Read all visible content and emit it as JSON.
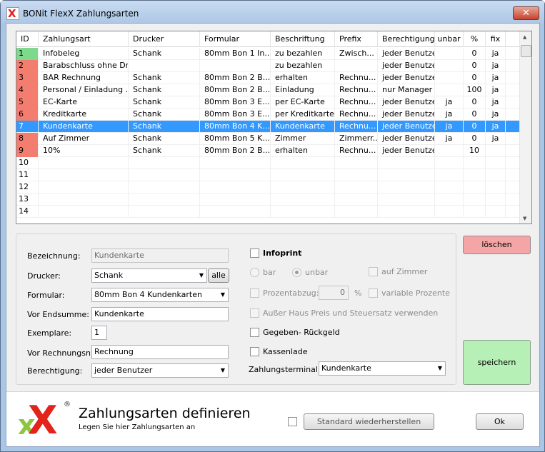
{
  "window": {
    "title": "BONit FlexX Zahlungsarten",
    "close_glyph": "✕"
  },
  "grid": {
    "columns": [
      "ID",
      "Zahlungsart",
      "Drucker",
      "Formular",
      "Beschriftung",
      "Prefix",
      "Berechtigung",
      "unbar",
      "%",
      "fix"
    ],
    "rows": [
      {
        "id": "1",
        "zahlungsart": "Infobeleg",
        "drucker": "Schank",
        "formular": "80mm Bon 1   In...",
        "beschriftung": "zu bezahlen",
        "prefix": "Zwisch...",
        "berechtigung": "jeder Benutzer",
        "unbar": "",
        "pct": "0",
        "fix": "ja",
        "color": "#7fd98c",
        "selected": false
      },
      {
        "id": "2",
        "zahlungsart": "Barabschluss ohne Dr...",
        "drucker": "",
        "formular": "",
        "beschriftung": "zu bezahlen",
        "prefix": "",
        "berechtigung": "jeder Benutzer",
        "unbar": "",
        "pct": "0",
        "fix": "ja",
        "color": "#f37d6f",
        "selected": false
      },
      {
        "id": "3",
        "zahlungsart": "BAR Rechnung",
        "drucker": "Schank",
        "formular": "80mm Bon 2   B...",
        "beschriftung": "erhalten",
        "prefix": "Rechnu...",
        "berechtigung": "jeder Benutzer",
        "unbar": "",
        "pct": "0",
        "fix": "ja",
        "color": "#f37d6f",
        "selected": false
      },
      {
        "id": "4",
        "zahlungsart": "Personal / Einladung ...",
        "drucker": "Schank",
        "formular": "80mm Bon 2   B...",
        "beschriftung": "Einladung",
        "prefix": "Rechnu...",
        "berechtigung": "nur Manager",
        "unbar": "",
        "pct": "100",
        "fix": "ja",
        "color": "#f37d6f",
        "selected": false
      },
      {
        "id": "5",
        "zahlungsart": "EC-Karte",
        "drucker": "Schank",
        "formular": "80mm Bon 3   E...",
        "beschriftung": "per EC-Karte",
        "prefix": "Rechnu...",
        "berechtigung": "jeder Benutzer",
        "unbar": "ja",
        "pct": "0",
        "fix": "ja",
        "color": "#f37d6f",
        "selected": false
      },
      {
        "id": "6",
        "zahlungsart": "Kreditkarte",
        "drucker": "Schank",
        "formular": "80mm Bon 3   E...",
        "beschriftung": "per Kreditkarte",
        "prefix": "Rechnu...",
        "berechtigung": "jeder Benutzer",
        "unbar": "ja",
        "pct": "0",
        "fix": "ja",
        "color": "#f37d6f",
        "selected": false
      },
      {
        "id": "7",
        "zahlungsart": "Kundenkarte",
        "drucker": "Schank",
        "formular": "80mm Bon 4   K...",
        "beschriftung": "Kundenkarte",
        "prefix": "Rechnu...",
        "berechtigung": "jeder Benutzer",
        "unbar": "ja",
        "pct": "0",
        "fix": "ja",
        "color": "",
        "selected": true
      },
      {
        "id": "8",
        "zahlungsart": "Auf Zimmer",
        "drucker": "Schank",
        "formular": "80mm Bon 5   K...",
        "beschriftung": "Zimmer",
        "prefix": "Zimmerr...",
        "berechtigung": "jeder Benutzer",
        "unbar": "ja",
        "pct": "0",
        "fix": "ja",
        "color": "#f37d6f",
        "selected": false
      },
      {
        "id": "9",
        "zahlungsart": "10%",
        "drucker": "Schank",
        "formular": "80mm Bon 2   B...",
        "beschriftung": "erhalten",
        "prefix": "Rechnu...",
        "berechtigung": "jeder Benutzer",
        "unbar": "",
        "pct": "10",
        "fix": "",
        "color": "#f37d6f",
        "selected": false
      },
      {
        "id": "10",
        "zahlungsart": "",
        "drucker": "",
        "formular": "",
        "beschriftung": "",
        "prefix": "",
        "berechtigung": "",
        "unbar": "",
        "pct": "",
        "fix": "",
        "color": "",
        "selected": false
      },
      {
        "id": "11",
        "zahlungsart": "",
        "drucker": "",
        "formular": "",
        "beschriftung": "",
        "prefix": "",
        "berechtigung": "",
        "unbar": "",
        "pct": "",
        "fix": "",
        "color": "",
        "selected": false
      },
      {
        "id": "12",
        "zahlungsart": "",
        "drucker": "",
        "formular": "",
        "beschriftung": "",
        "prefix": "",
        "berechtigung": "",
        "unbar": "",
        "pct": "",
        "fix": "",
        "color": "",
        "selected": false
      },
      {
        "id": "13",
        "zahlungsart": "",
        "drucker": "",
        "formular": "",
        "beschriftung": "",
        "prefix": "",
        "berechtigung": "",
        "unbar": "",
        "pct": "",
        "fix": "",
        "color": "",
        "selected": false
      },
      {
        "id": "14",
        "zahlungsart": "",
        "drucker": "",
        "formular": "",
        "beschriftung": "",
        "prefix": "",
        "berechtigung": "",
        "unbar": "",
        "pct": "",
        "fix": "",
        "color": "",
        "selected": false
      }
    ]
  },
  "form": {
    "bezeichnung_label": "Bezeichnung:",
    "bezeichnung_value": "Kundenkarte",
    "drucker_label": "Drucker:",
    "drucker_value": "Schank",
    "alle_label": "alle",
    "formular_label": "Formular:",
    "formular_value": "80mm Bon 4   Kundenkarten",
    "vor_endsumme_label": "Vor Endsumme:",
    "vor_endsumme_value": "Kundenkarte",
    "exemplare_label": "Exemplare:",
    "exemplare_value": "1",
    "vor_rechnungsnr_label": "Vor Rechnungsnr.:",
    "vor_rechnungsnr_value": "Rechnung",
    "berechtigung_label": "Berechtigung:",
    "berechtigung_value": "jeder Benutzer",
    "infoprint_label": "Infoprint",
    "bar_label": "bar",
    "unbar_label": "unbar",
    "auf_zimmer_label": "auf Zimmer",
    "prozentabzug_label": "Prozentabzug:",
    "prozentabzug_value": "0",
    "percent_sign": "%",
    "variable_prozente_label": "variable Prozente",
    "ausser_haus_label": "Außer Haus Preis und Steuersatz verwenden",
    "gegeben_rueckgeld_label": "Gegeben- Rückgeld",
    "kassenlade_label": "Kassenlade",
    "zahlungsterminal_label": "Zahlungsterminal:",
    "zahlungsterminal_value": "Kundenkarte"
  },
  "actions": {
    "loeschen_label": "löschen",
    "speichern_label": "speichern",
    "loeschen_color": "#f4a6a6",
    "speichern_color": "#b6f0b6"
  },
  "footer": {
    "title": "Zahlungsarten definieren",
    "subtitle": "Legen Sie hier Zahlungsarten an",
    "standard_label": "Standard wiederherstellen",
    "ok_label": "Ok",
    "logo_reg": "®"
  }
}
